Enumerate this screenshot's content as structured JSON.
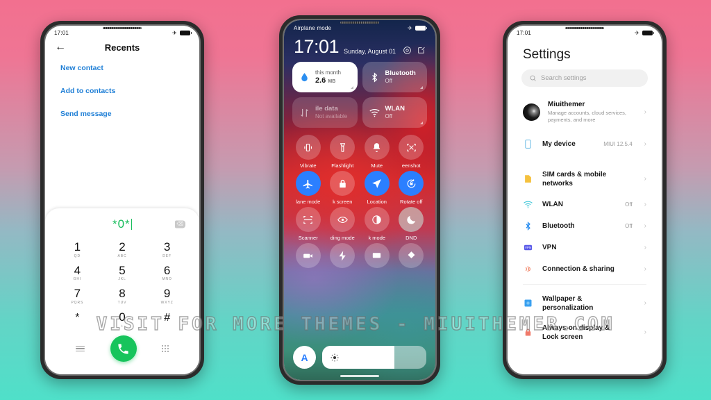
{
  "background": {
    "top_color": "#f2708f",
    "bottom_color": "#4fe0c9"
  },
  "watermark": {
    "text": "VISIT FOR MORE THEMES - MIUITHEMER.COM"
  },
  "phone_dialer": {
    "status_bar": {
      "time": "17:01",
      "airplane_icon": "airplane-icon",
      "battery_icon": "battery-icon"
    },
    "header": {
      "back_icon": "back-arrow-icon",
      "title": "Recents"
    },
    "links": [
      {
        "label": "New contact"
      },
      {
        "label": "Add to contacts"
      },
      {
        "label": "Send message"
      }
    ],
    "dial_input": {
      "value": "*0*",
      "backspace_icon": "backspace-icon"
    },
    "keypad": [
      {
        "digit": "1",
        "letters": "QD"
      },
      {
        "digit": "2",
        "letters": "ABC"
      },
      {
        "digit": "3",
        "letters": "DEF"
      },
      {
        "digit": "4",
        "letters": "GHI"
      },
      {
        "digit": "5",
        "letters": "JKL"
      },
      {
        "digit": "6",
        "letters": "MNO"
      },
      {
        "digit": "7",
        "letters": "PQRS"
      },
      {
        "digit": "8",
        "letters": "TUV"
      },
      {
        "digit": "9",
        "letters": "WXYZ"
      },
      {
        "digit": "*",
        "letters": ""
      },
      {
        "digit": "0",
        "letters": "+"
      },
      {
        "digit": "#",
        "letters": ""
      }
    ],
    "bottom_bar": {
      "menu_icon": "menu-lines-icon",
      "call_icon": "call-phone-icon",
      "keypad_icon": "keypad-dots-icon",
      "call_button_color": "#17c45c"
    }
  },
  "phone_control_center": {
    "status_bar": {
      "label": "Airplane mode",
      "airplane_icon": "airplane-icon",
      "battery_icon": "battery-icon"
    },
    "clock": {
      "time": "17:01",
      "date": "Sunday, August 01"
    },
    "header_icons": [
      {
        "name": "settings-gear-icon"
      },
      {
        "name": "edit-pencil-icon"
      }
    ],
    "big_tiles": [
      {
        "icon": "data-usage-drop-icon",
        "top_label": "this month",
        "value": "2.6",
        "unit": "MB",
        "state": "on"
      },
      {
        "icon": "bluetooth-icon",
        "title": "Bluetooth",
        "sub": "Off",
        "state": "off"
      },
      {
        "icon": "mobile-data-icon",
        "title": "ile data",
        "sub": "Not available",
        "state": "disabled"
      },
      {
        "icon": "wlan-wifi-icon",
        "title": "WLAN",
        "sub": "Off",
        "state": "off"
      }
    ],
    "toggles": [
      {
        "icon": "vibrate-icon",
        "label": "Vibrate",
        "state": "off"
      },
      {
        "icon": "flashlight-icon",
        "label": "Flashlight",
        "state": "off"
      },
      {
        "icon": "bell-mute-icon",
        "label": "Mute",
        "state": "off"
      },
      {
        "icon": "screenshot-icon",
        "label": "eenshot",
        "state": "off"
      },
      {
        "icon": "airplane-icon",
        "label": "lane mode",
        "state": "on"
      },
      {
        "icon": "lock-icon",
        "label": "k screen",
        "state": "off"
      },
      {
        "icon": "location-icon",
        "label": "Location",
        "state": "on"
      },
      {
        "icon": "rotate-lock-icon",
        "label": "Rotate off",
        "state": "on"
      },
      {
        "icon": "scanner-icon",
        "label": "Scanner",
        "state": "off"
      },
      {
        "icon": "reading-eye-icon",
        "label": "ding mode",
        "state": "off"
      },
      {
        "icon": "dark-mode-icon",
        "label": "k mode",
        "state": "off"
      },
      {
        "icon": "moon-dnd-icon",
        "label": "DND",
        "state": "mint"
      }
    ],
    "partial_row": [
      {
        "icon": "screen-record-icon"
      },
      {
        "icon": "power-flash-icon"
      },
      {
        "icon": "cast-screen-icon"
      },
      {
        "icon": "video-toolbox-icon"
      }
    ],
    "brightness": {
      "auto_label": "A",
      "sun_icon": "brightness-sun-icon",
      "fill_percent": 69
    }
  },
  "phone_settings": {
    "status_bar": {
      "time": "17:01",
      "airplane_icon": "airplane-icon",
      "battery_icon": "battery-icon"
    },
    "page_title": "Settings",
    "search": {
      "icon": "search-icon",
      "placeholder": "Search settings"
    },
    "account": {
      "avatar_icon": "user-avatar",
      "name": "Miuithemer",
      "subtitle": "Manage accounts, cloud services, payments, and more",
      "chevron": "chevron-right-icon"
    },
    "items": [
      {
        "icon": "my-device-icon",
        "label": "My device",
        "value": "MIUI 12.5.4",
        "color": "#7fc4e8"
      },
      {
        "icon": "sim-card-icon",
        "label": "SIM cards & mobile networks",
        "value": "",
        "color": "#f5c13d"
      },
      {
        "icon": "wlan-wifi-icon",
        "label": "WLAN",
        "value": "Off",
        "color": "#3fc6d8"
      },
      {
        "icon": "bluetooth-icon",
        "label": "Bluetooth",
        "value": "Off",
        "color": "#2b8ef0"
      },
      {
        "icon": "vpn-icon",
        "label": "VPN",
        "value": "",
        "color": "#5a5ae8"
      },
      {
        "icon": "connection-sharing-icon",
        "label": "Connection & sharing",
        "value": "",
        "color": "#f07a5a"
      },
      {
        "icon": "wallpaper-icon",
        "label": "Wallpaper & personalization",
        "value": "",
        "color": "#3aa0f0"
      },
      {
        "icon": "lock-display-icon",
        "label": "Always-on display & Lock screen",
        "value": "",
        "color": "#f07a6a"
      }
    ]
  }
}
